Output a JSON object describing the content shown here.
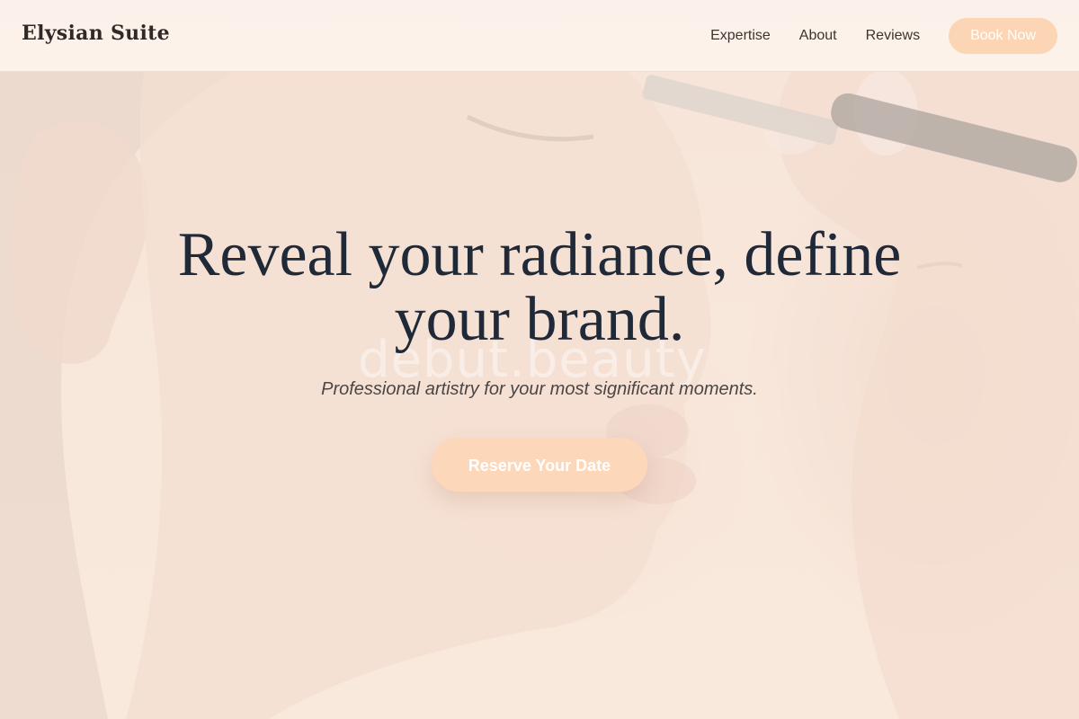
{
  "brand": {
    "name": "Elysian Suite"
  },
  "nav": {
    "items": [
      {
        "label": "Expertise"
      },
      {
        "label": "About"
      },
      {
        "label": "Reviews"
      }
    ],
    "cta_label": "Book Now"
  },
  "hero": {
    "title": "Reveal your radiance, define your brand.",
    "subtitle": "Professional artistry for your most significant moments.",
    "cta_label": "Reserve Your Date",
    "watermark": "debut.beauty"
  },
  "colors": {
    "accent": "#fcd5b5",
    "heading": "#1f2937",
    "background": "#f6e7dc"
  }
}
